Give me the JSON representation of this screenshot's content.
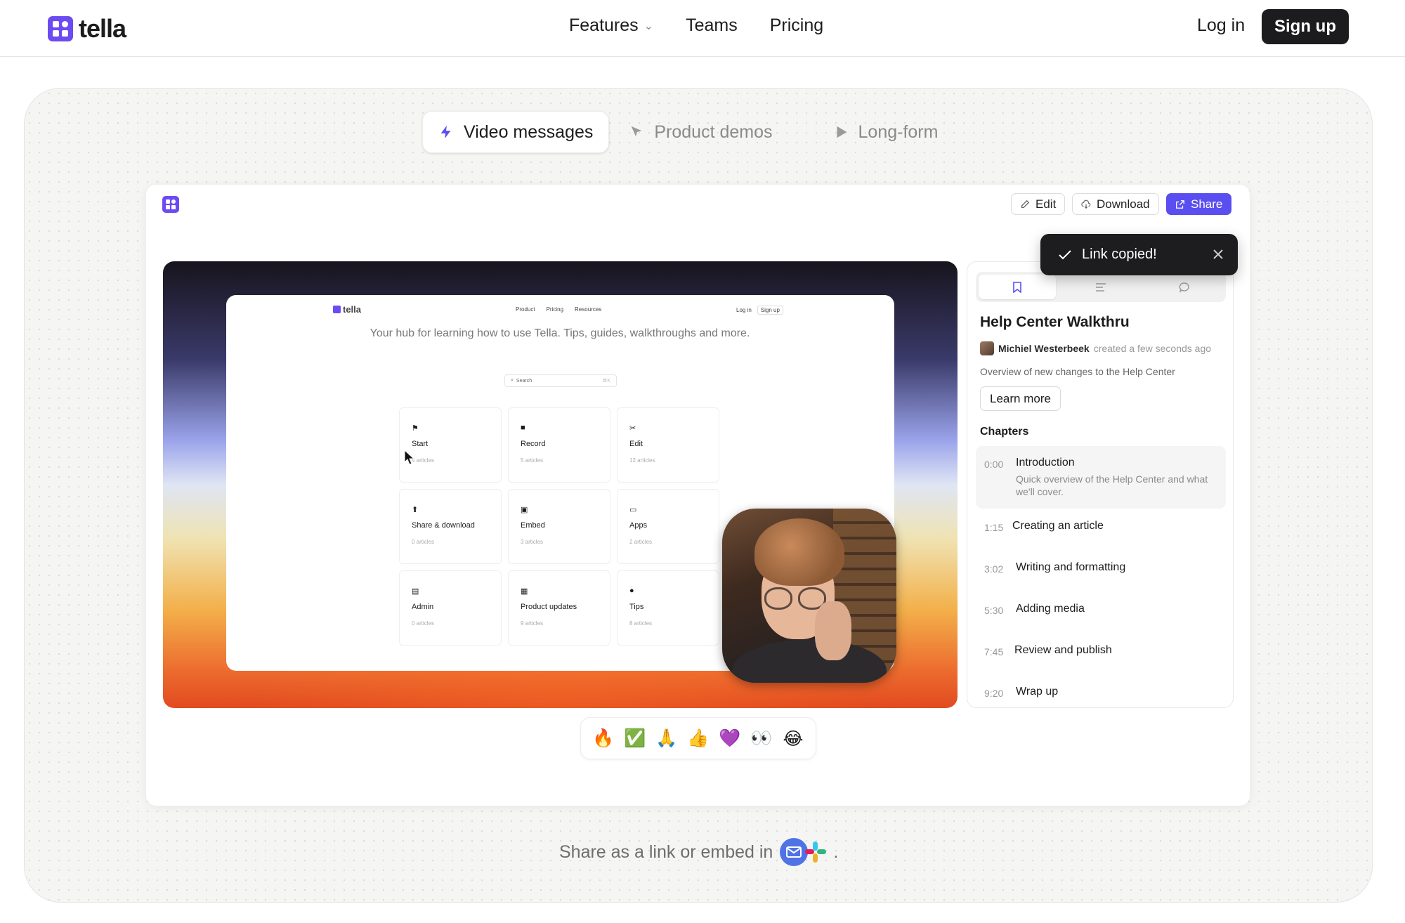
{
  "nav": {
    "brand": "tella",
    "links": [
      {
        "label": "Features",
        "has_dropdown": true
      },
      {
        "label": "Teams"
      },
      {
        "label": "Pricing"
      }
    ],
    "login": "Log in",
    "signup": "Sign up"
  },
  "tabs": [
    {
      "label": "Video messages",
      "icon": "lightning-icon",
      "active": true
    },
    {
      "label": "Product demos",
      "icon": "cursor-icon",
      "active": false
    },
    {
      "label": "Long-form",
      "icon": "play-icon",
      "active": false
    }
  ],
  "player": {
    "actions": {
      "edit": "Edit",
      "download": "Download",
      "share": "Share"
    },
    "toast": "Link copied!",
    "screen": {
      "brand": "tella",
      "nav": [
        "Product",
        "Pricing",
        "Resources"
      ],
      "login": "Log in",
      "signup": "Sign up",
      "hero": "Your hub for learning how to use Tella. Tips, guides, walkthroughs and more.",
      "search_placeholder": "Search",
      "search_shortcut": "⌘K",
      "tiles": [
        {
          "icon": "⚑",
          "name": "Start",
          "count": "4 articles"
        },
        {
          "icon": "■",
          "name": "Record",
          "count": "5 articles"
        },
        {
          "icon": "✂",
          "name": "Edit",
          "count": "12 articles"
        },
        {
          "icon": "⬆",
          "name": "Share & download",
          "count": "0 articles"
        },
        {
          "icon": "▣",
          "name": "Embed",
          "count": "3 articles"
        },
        {
          "icon": "▭",
          "name": "Apps",
          "count": "2 articles"
        },
        {
          "icon": "▤",
          "name": "Admin",
          "count": "0 articles"
        },
        {
          "icon": "▦",
          "name": "Product updates",
          "count": "9 articles"
        },
        {
          "icon": "●",
          "name": "Tips",
          "count": "8 articles"
        }
      ]
    },
    "reactions": [
      "🔥",
      "✅",
      "🙏",
      "👍",
      "💜",
      "👀",
      "😂"
    ]
  },
  "panel": {
    "title": "Help Center Walkthru",
    "author": "Michiel Westerbeek",
    "created": "created a few seconds ago",
    "description": "Overview of new changes to the Help Center",
    "learn_more": "Learn more",
    "chapters_heading": "Chapters",
    "chapters": [
      {
        "time": "0:00",
        "title": "Introduction",
        "desc": "Quick overview of the Help Center and what we'll cover.",
        "active": true
      },
      {
        "time": "1:15",
        "title": "Creating an article"
      },
      {
        "time": "3:02",
        "title": "Writing and formatting"
      },
      {
        "time": "5:30",
        "title": "Adding media"
      },
      {
        "time": "7:45",
        "title": "Review and publish"
      },
      {
        "time": "9:20",
        "title": "Wrap up"
      }
    ]
  },
  "footer": {
    "share_text": "Share as a link or embed in",
    "suffix": "."
  },
  "colors": {
    "brand": "#6c4bf2",
    "share_button": "#5b4ef0",
    "dark_button": "#1c1c1e"
  }
}
